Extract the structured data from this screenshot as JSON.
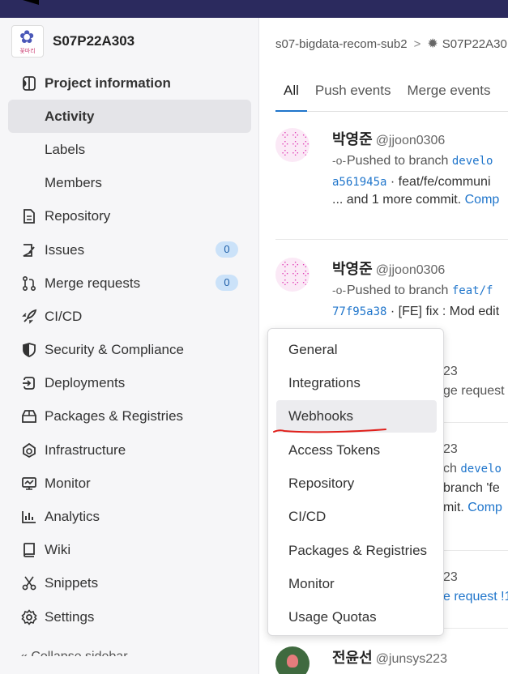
{
  "project": {
    "name": "S07P22A303",
    "avatar_caption": "꽃마리"
  },
  "sidebar": {
    "items": [
      {
        "label": "Project information",
        "icon": "info-panel-icon"
      },
      {
        "label": "Activity"
      },
      {
        "label": "Labels"
      },
      {
        "label": "Members"
      },
      {
        "label": "Repository",
        "icon": "document-icon"
      },
      {
        "label": "Issues",
        "icon": "issues-icon",
        "count": "0"
      },
      {
        "label": "Merge requests",
        "icon": "merge-request-icon",
        "count": "0"
      },
      {
        "label": "CI/CD",
        "icon": "rocket-icon"
      },
      {
        "label": "Security & Compliance",
        "icon": "shield-icon"
      },
      {
        "label": "Deployments",
        "icon": "deployments-icon"
      },
      {
        "label": "Packages & Registries",
        "icon": "package-icon"
      },
      {
        "label": "Infrastructure",
        "icon": "cloud-gear-icon"
      },
      {
        "label": "Monitor",
        "icon": "monitor-icon"
      },
      {
        "label": "Analytics",
        "icon": "chart-icon"
      },
      {
        "label": "Wiki",
        "icon": "book-icon"
      },
      {
        "label": "Snippets",
        "icon": "scissors-icon"
      },
      {
        "label": "Settings",
        "icon": "gear-icon"
      }
    ],
    "collapse_label": "« Collapse sidebar"
  },
  "breadcrumb": {
    "group": "s07-bigdata-recom-sub2",
    "separator": ">",
    "project": "S07P22A30"
  },
  "tabs": [
    "All",
    "Push events",
    "Merge events"
  ],
  "events": [
    {
      "user": "박영준",
      "handle": "@jjoon0306",
      "action": "Pushed to branch",
      "branch": "develo",
      "commit_sha": "a561945a",
      "commit_msg": "· feat/fe/communi",
      "more": "... and 1 more commit.",
      "compare": "Comp"
    },
    {
      "user": "박영준",
      "handle": "@jjoon0306",
      "action": "Pushed to branch",
      "branch": "feat/f",
      "commit_sha": "77f95a38",
      "commit_msg": "· [FE] fix : Mod edit"
    },
    {
      "partial_handle": "23",
      "partial_line": "ge request"
    },
    {
      "partial_handle": "23",
      "partial_line": "ch",
      "branch": "develo",
      "line3": "branch 'fe",
      "line4": "mit.",
      "compare": "Comp"
    },
    {
      "partial_handle": "23",
      "partial_line": "e request !1"
    },
    {
      "user": "전윤선",
      "handle": "@junsys223"
    }
  ],
  "settings_menu": {
    "items": [
      "General",
      "Integrations",
      "Webhooks",
      "Access Tokens",
      "Repository",
      "CI/CD",
      "Packages & Registries",
      "Monitor",
      "Usage Quotas"
    ],
    "highlighted": "Webhooks"
  },
  "colors": {
    "topbar": "#2b2a5e",
    "accent": "#1f75cb",
    "badge_bg": "#cbe2f9",
    "annotation": "#e0201b"
  }
}
